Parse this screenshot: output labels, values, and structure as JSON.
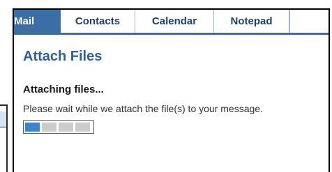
{
  "tabs": [
    {
      "label": "Mail",
      "active": true
    },
    {
      "label": "Contacts",
      "active": false
    },
    {
      "label": "Calendar",
      "active": false
    },
    {
      "label": "Notepad",
      "active": false
    }
  ],
  "page": {
    "title": "Attach Files",
    "subtitle": "Attaching files...",
    "message": "Please wait while we attach the file(s) to your message."
  },
  "progress": {
    "segments_total": 4,
    "segments_filled": 1
  },
  "colors": {
    "accent": "#3a6ea5",
    "title": "#2e5f99",
    "progress_fill": "#3a86c8",
    "progress_empty": "#cccccc"
  }
}
